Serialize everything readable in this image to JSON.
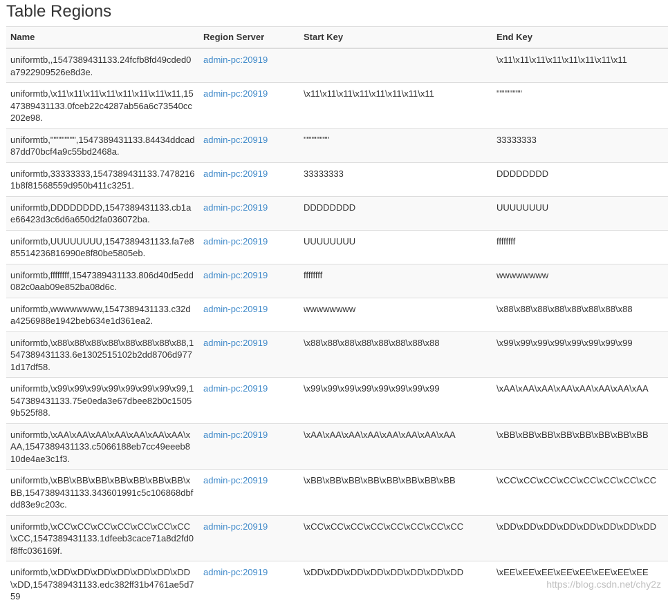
{
  "page_title": "Table Regions",
  "columns": {
    "name": "Name",
    "server": "Region Server",
    "start": "Start Key",
    "end": "End Key"
  },
  "rows": [
    {
      "name": "uniformtb,,1547389431133.24fcfb8fd49cded0a7922909526e8d3e.",
      "server": "admin-pc:20919",
      "start": "",
      "end": "\\x11\\x11\\x11\\x11\\x11\\x11\\x11\\x11"
    },
    {
      "name": "uniformtb,\\x11\\x11\\x11\\x11\\x11\\x11\\x11\\x11,1547389431133.0fceb22c4287ab56a6c73540cc202e98.",
      "server": "admin-pc:20919",
      "start": "\\x11\\x11\\x11\\x11\\x11\\x11\\x11\\x11",
      "end": "\"\"\"\"\"\"\"\""
    },
    {
      "name": "uniformtb,\"\"\"\"\"\"\"\",1547389431133.84434ddcad87dd70bcf4a9c55bd2468a.",
      "server": "admin-pc:20919",
      "start": "\"\"\"\"\"\"\"\"",
      "end": "33333333"
    },
    {
      "name": "uniformtb,33333333,1547389431133.74782161b8f81568559d950b411c3251.",
      "server": "admin-pc:20919",
      "start": "33333333",
      "end": "DDDDDDDD"
    },
    {
      "name": "uniformtb,DDDDDDDD,1547389431133.cb1ae66423d3c6d6a650d2fa036072ba.",
      "server": "admin-pc:20919",
      "start": "DDDDDDDD",
      "end": "UUUUUUUU"
    },
    {
      "name": "uniformtb,UUUUUUUU,1547389431133.fa7e885514236816990e8f80be5805eb.",
      "server": "admin-pc:20919",
      "start": "UUUUUUUU",
      "end": "ffffffff"
    },
    {
      "name": "uniformtb,ffffffff,1547389431133.806d40d5edd082c0aab09e852ba08d6c.",
      "server": "admin-pc:20919",
      "start": "ffffffff",
      "end": "wwwwwwww"
    },
    {
      "name": "uniformtb,wwwwwwww,1547389431133.c32da4256988e1942beb634e1d361ea2.",
      "server": "admin-pc:20919",
      "start": "wwwwwwww",
      "end": "\\x88\\x88\\x88\\x88\\x88\\x88\\x88\\x88"
    },
    {
      "name": "uniformtb,\\x88\\x88\\x88\\x88\\x88\\x88\\x88\\x88,1547389431133.6e1302515102b2dd8706d9771d17df58.",
      "server": "admin-pc:20919",
      "start": "\\x88\\x88\\x88\\x88\\x88\\x88\\x88\\x88",
      "end": "\\x99\\x99\\x99\\x99\\x99\\x99\\x99\\x99"
    },
    {
      "name": "uniformtb,\\x99\\x99\\x99\\x99\\x99\\x99\\x99\\x99,1547389431133.75e0eda3e67dbee82b0c15059b525f88.",
      "server": "admin-pc:20919",
      "start": "\\x99\\x99\\x99\\x99\\x99\\x99\\x99\\x99",
      "end": "\\xAA\\xAA\\xAA\\xAA\\xAA\\xAA\\xAA\\xAA"
    },
    {
      "name": "uniformtb,\\xAA\\xAA\\xAA\\xAA\\xAA\\xAA\\xAA\\xAA,1547389431133.c5066188eb7cc49eeeb810de4ae3c1f3.",
      "server": "admin-pc:20919",
      "start": "\\xAA\\xAA\\xAA\\xAA\\xAA\\xAA\\xAA\\xAA",
      "end": "\\xBB\\xBB\\xBB\\xBB\\xBB\\xBB\\xBB\\xBB"
    },
    {
      "name": "uniformtb,\\xBB\\xBB\\xBB\\xBB\\xBB\\xBB\\xBB\\xBB,1547389431133.343601991c5c106868dbfdd83e9c203c.",
      "server": "admin-pc:20919",
      "start": "\\xBB\\xBB\\xBB\\xBB\\xBB\\xBB\\xBB\\xBB",
      "end": "\\xCC\\xCC\\xCC\\xCC\\xCC\\xCC\\xCC\\xCC"
    },
    {
      "name": "uniformtb,\\xCC\\xCC\\xCC\\xCC\\xCC\\xCC\\xCC\\xCC,1547389431133.1dfeeb3cace71a8d2fd0f8ffc036169f.",
      "server": "admin-pc:20919",
      "start": "\\xCC\\xCC\\xCC\\xCC\\xCC\\xCC\\xCC\\xCC",
      "end": "\\xDD\\xDD\\xDD\\xDD\\xDD\\xDD\\xDD\\xDD"
    },
    {
      "name": "uniformtb,\\xDD\\xDD\\xDD\\xDD\\xDD\\xDD\\xDD\\xDD,1547389431133.edc382ff31b4761ae5d759",
      "server": "admin-pc:20919",
      "start": "\\xDD\\xDD\\xDD\\xDD\\xDD\\xDD\\xDD\\xDD",
      "end": "\\xEE\\xEE\\xEE\\xEE\\xEE\\xEE\\xEE\\xEE"
    }
  ],
  "watermark": "https://blog.csdn.net/chy2z",
  "colors": {
    "link": "#428bca",
    "text": "#333333",
    "stripe": "#f9f9f9",
    "border": "#dddddd"
  }
}
